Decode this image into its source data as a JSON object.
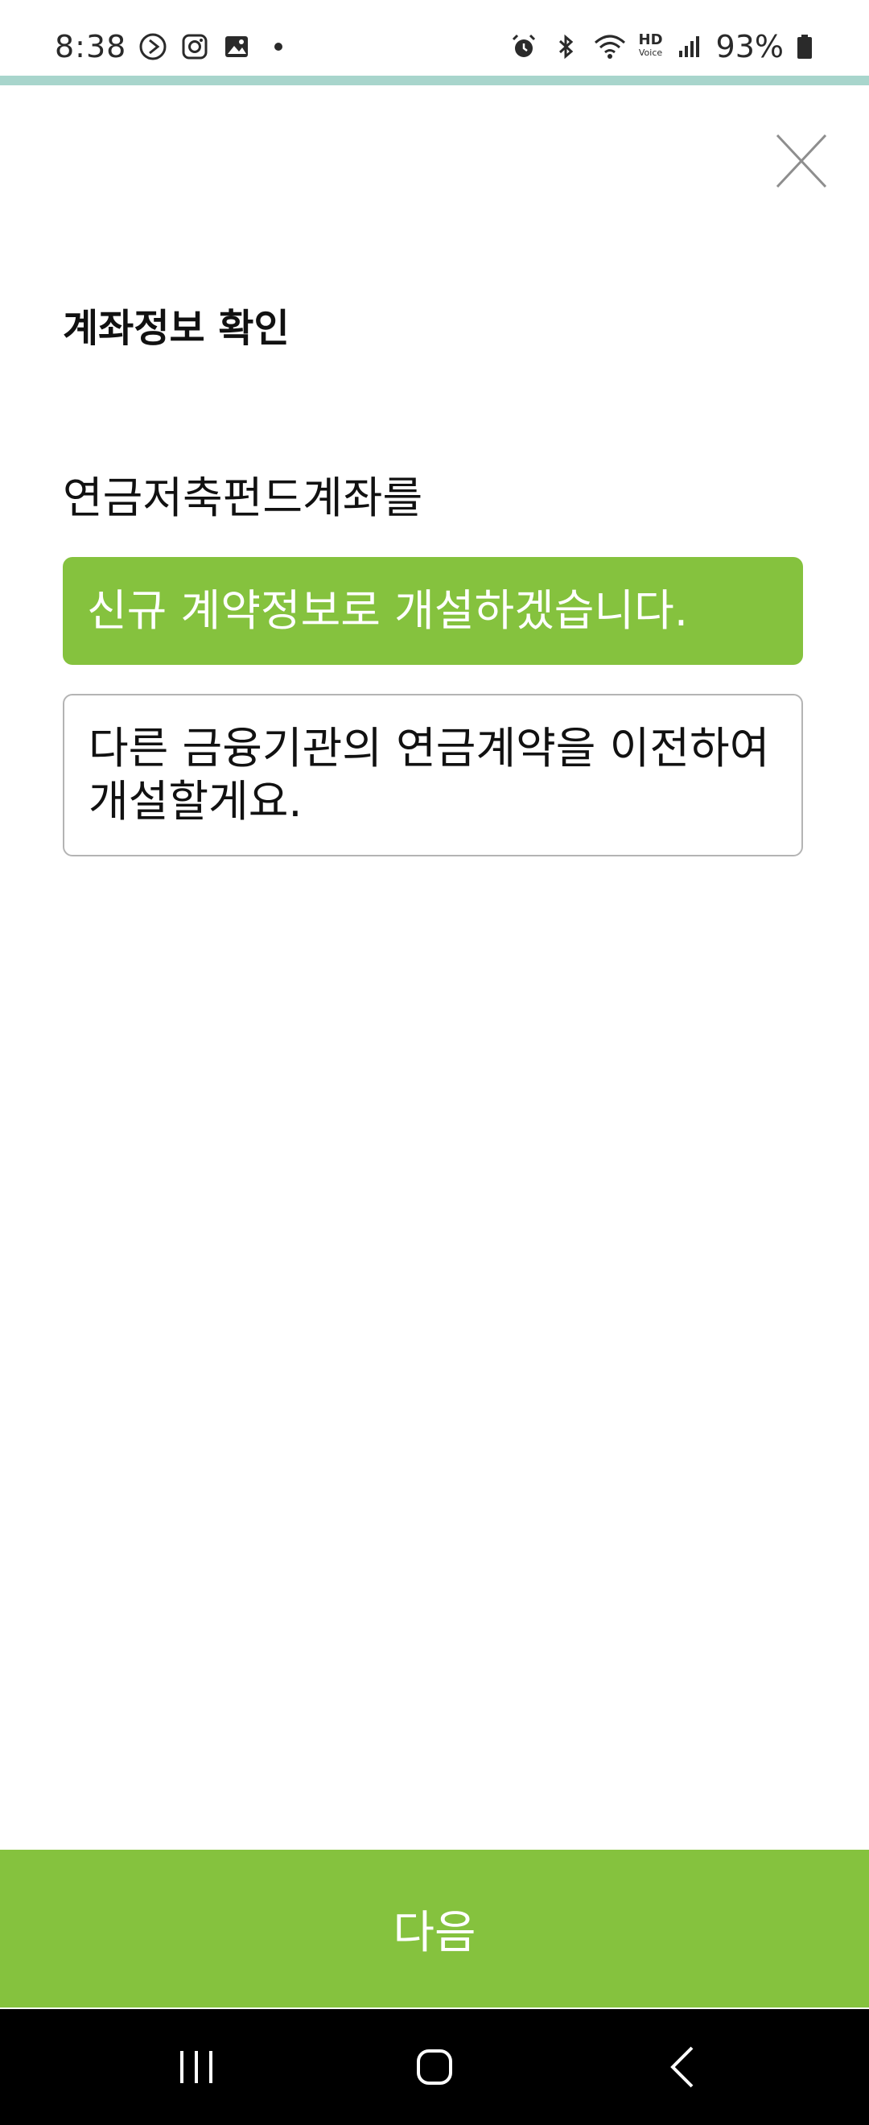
{
  "status_bar": {
    "time": "8:38",
    "battery": "93%",
    "left_icons": [
      "media-play-icon",
      "instagram-icon",
      "gallery-icon",
      "notification-dot-icon"
    ],
    "right_icons": [
      "alarm-icon",
      "bluetooth-icon",
      "wifi-icon",
      "hd-voice-icon",
      "signal-icon",
      "battery-icon"
    ],
    "hd_label": "HD",
    "voice_label": "Voice"
  },
  "progress": {
    "fraction": 1.0,
    "color": "#a8d5cc"
  },
  "header": {
    "close_icon": "close-icon"
  },
  "page": {
    "title": "계좌정보 확인",
    "question": "연금저축펀드계좌를",
    "options": [
      {
        "label": "신규 계약정보로 개설하겠습니다.",
        "selected": true
      },
      {
        "label": "다른 금융기관의 연금계약을 이전하여 개설할게요.",
        "selected": false
      }
    ]
  },
  "footer": {
    "next_label": "다음"
  },
  "nav_bar": {
    "icons": [
      "recent-apps-icon",
      "home-icon",
      "back-icon"
    ]
  },
  "colors": {
    "accent": "#85c23e",
    "progress": "#a8d5cc",
    "border": "#b4b4b4"
  }
}
